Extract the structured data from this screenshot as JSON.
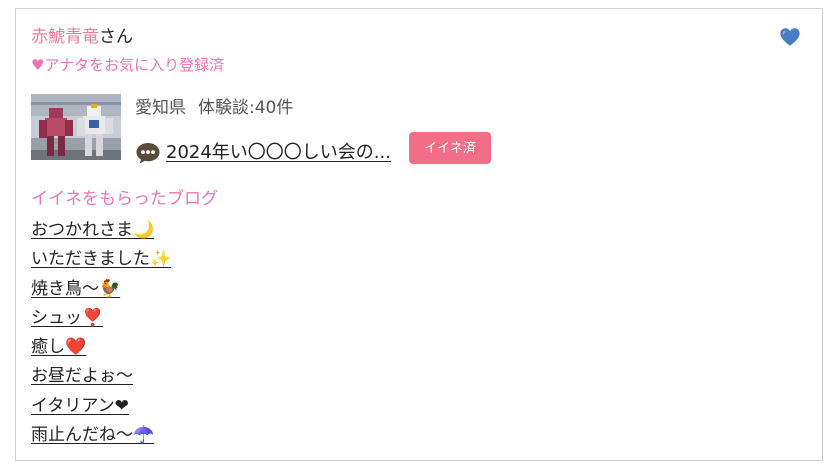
{
  "profile": {
    "name": "赤鯱青竜",
    "honorific": "さん",
    "favorite_status": "♥アナタをお気に入り登録済",
    "favorite_icon": "blue-heart-icon",
    "prefecture": "愛知県",
    "experience_count": "体験談:40件",
    "thumbnail_icon": "profile-thumbnail-image"
  },
  "latest_post": {
    "icon": "speech-bubble-icon",
    "title": "2024年い〇〇〇しい会の...",
    "iine_button": "イイネ済"
  },
  "liked_blogs": {
    "heading": "イイネをもらったブログ",
    "items": [
      "おつかれさま🌙",
      "いただきました✨",
      "焼き鳥〜🐓",
      "シュッ❣️",
      "癒し❤️",
      "お昼だよぉ〜",
      "イタリアン❤",
      "雨止んだね〜☂️"
    ]
  },
  "colors": {
    "name_pink": "#f07a9a",
    "status_pink": "#ef74b8",
    "button_pink": "#f26d87",
    "heart_blue": "#4a7cc4",
    "border": "#cfcfcf"
  }
}
